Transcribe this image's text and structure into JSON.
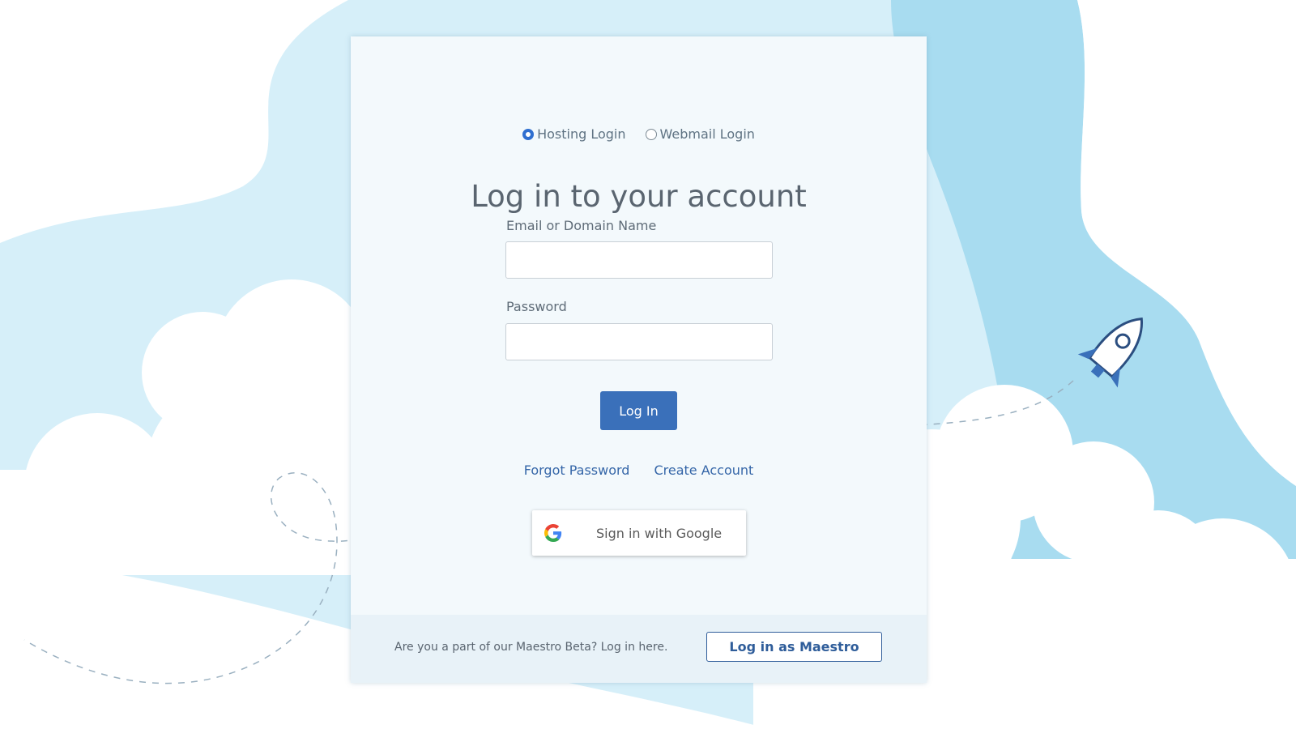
{
  "login_type": {
    "options": [
      {
        "label": "Hosting Login",
        "selected": true
      },
      {
        "label": "Webmail Login",
        "selected": false
      }
    ]
  },
  "heading": "Log in to your account",
  "email": {
    "label": "Email or Domain Name",
    "value": "",
    "placeholder": ""
  },
  "password": {
    "label": "Password",
    "value": "",
    "placeholder": ""
  },
  "login_button": "Log In",
  "links": {
    "forgot": "Forgot Password",
    "create": "Create Account"
  },
  "google_button": "Sign in with Google",
  "footer": {
    "text": "Are you a part of our Maestro Beta? Log in here.",
    "button": "Log in as Maestro"
  },
  "colors": {
    "primary": "#3a70ba",
    "link": "#3566a8",
    "sky": "#a8dcf0",
    "card_bg": "#f3f9fc"
  },
  "icons": [
    "radio-icon",
    "google-icon",
    "rocket-icon",
    "cloud-icon"
  ]
}
